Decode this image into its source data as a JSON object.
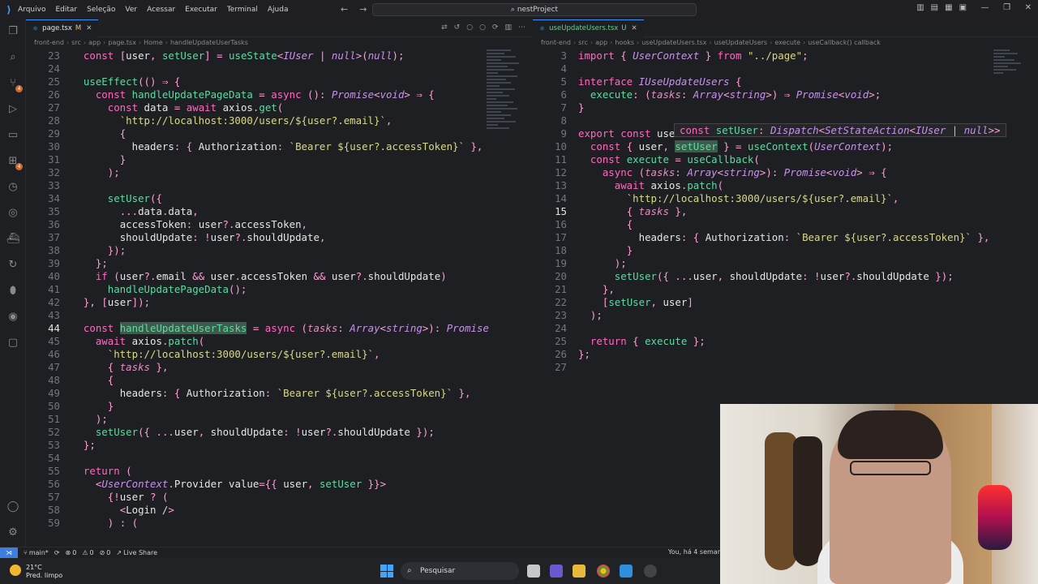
{
  "menu": [
    "Arquivo",
    "Editar",
    "Seleção",
    "Ver",
    "Acessar",
    "Executar",
    "Terminal",
    "Ajuda"
  ],
  "search_label": "nestProject",
  "left": {
    "tab": "page.tsx",
    "tab_status": "M",
    "breadcrumbs": [
      "front-end",
      "src",
      "app",
      "page.tsx",
      "Home",
      "handleUpdateUserTasks"
    ],
    "lines": [
      {
        "n": "23",
        "t": "  const [user, setUser] = useState<IUser | null>(null);"
      },
      {
        "n": "24",
        "t": ""
      },
      {
        "n": "25",
        "t": "  useEffect(() ⇒ {"
      },
      {
        "n": "26",
        "t": "    const handleUpdatePageData = async (): Promise<void> ⇒ {"
      },
      {
        "n": "27",
        "t": "      const data = await axios.get("
      },
      {
        "n": "28",
        "t": "        `http://localhost:3000/users/${user?.email}`,"
      },
      {
        "n": "29",
        "t": "        {"
      },
      {
        "n": "30",
        "t": "          headers: { Authorization: `Bearer ${user?.accessToken}` },"
      },
      {
        "n": "31",
        "t": "        }"
      },
      {
        "n": "32",
        "t": "      );"
      },
      {
        "n": "33",
        "t": ""
      },
      {
        "n": "34",
        "t": "      setUser({"
      },
      {
        "n": "35",
        "t": "        ...data.data,"
      },
      {
        "n": "36",
        "t": "        accessToken: user?.accessToken,"
      },
      {
        "n": "37",
        "t": "        shouldUpdate: !user?.shouldUpdate,"
      },
      {
        "n": "38",
        "t": "      });"
      },
      {
        "n": "39",
        "t": "    };"
      },
      {
        "n": "40",
        "t": "    if (user?.email && user.accessToken && user?.shouldUpdate)"
      },
      {
        "n": "41",
        "t": "      handleUpdatePageData();"
      },
      {
        "n": "42",
        "t": "  }, [user]);"
      },
      {
        "n": "43",
        "t": ""
      },
      {
        "n": "44",
        "t": "  const handleUpdateUserTasks = async (tasks: Array<string>): Promise"
      },
      {
        "n": "45",
        "t": "    await axios.patch("
      },
      {
        "n": "46",
        "t": "      `http://localhost:3000/users/${user?.email}`,"
      },
      {
        "n": "47",
        "t": "      { tasks },"
      },
      {
        "n": "48",
        "t": "      {"
      },
      {
        "n": "49",
        "t": "        headers: { Authorization: `Bearer ${user?.accessToken}` },"
      },
      {
        "n": "50",
        "t": "      }"
      },
      {
        "n": "51",
        "t": "    );"
      },
      {
        "n": "52",
        "t": "    setUser({ ...user, shouldUpdate: !user?.shouldUpdate });"
      },
      {
        "n": "53",
        "t": "  };"
      },
      {
        "n": "54",
        "t": ""
      },
      {
        "n": "55",
        "t": "  return ("
      },
      {
        "n": "56",
        "t": "    <UserContext.Provider value={{ user, setUser }}>"
      },
      {
        "n": "57",
        "t": "      {!user ? ("
      },
      {
        "n": "58",
        "t": "        <Login />"
      },
      {
        "n": "59",
        "t": "      ) : ("
      }
    ]
  },
  "right": {
    "tab": "useUpdateUsers.tsx",
    "tab_status": "U",
    "breadcrumbs": [
      "front-end",
      "src",
      "app",
      "hooks",
      "useUpdateUsers.tsx",
      "useUpdateUsers",
      "execute",
      "useCallback() callback"
    ],
    "lines": [
      {
        "n": "3",
        "t": "import { UserContext } from \"../page\";"
      },
      {
        "n": "4",
        "t": ""
      },
      {
        "n": "5",
        "t": "interface IUseUpdateUsers {"
      },
      {
        "n": "6",
        "t": "  execute: (tasks: Array<string>) ⇒ Promise<void>;"
      },
      {
        "n": "7",
        "t": "}"
      },
      {
        "n": "8",
        "t": ""
      },
      {
        "n": "9",
        "t": "export const use"
      },
      {
        "n": "10",
        "t": "  const { user, setUser } = useContext(UserContext);"
      },
      {
        "n": "11",
        "t": "  const execute = useCallback("
      },
      {
        "n": "12",
        "t": "    async (tasks: Array<string>): Promise<void> ⇒ {"
      },
      {
        "n": "13",
        "t": "      await axios.patch("
      },
      {
        "n": "14",
        "t": "        `http://localhost:3000/users/${user?.email}`,"
      },
      {
        "n": "15",
        "t": "        { tasks },"
      },
      {
        "n": "16",
        "t": "        {"
      },
      {
        "n": "17",
        "t": "          headers: { Authorization: `Bearer ${user?.accessToken}` },"
      },
      {
        "n": "18",
        "t": "        }"
      },
      {
        "n": "19",
        "t": "      );"
      },
      {
        "n": "20",
        "t": "      setUser({ ...user, shouldUpdate: !user?.shouldUpdate });"
      },
      {
        "n": "21",
        "t": "    },"
      },
      {
        "n": "22",
        "t": "    [setUser, user]"
      },
      {
        "n": "23",
        "t": "  );"
      },
      {
        "n": "24",
        "t": ""
      },
      {
        "n": "25",
        "t": "  return { execute };"
      },
      {
        "n": "26",
        "t": "};"
      },
      {
        "n": "27",
        "t": ""
      }
    ],
    "hover": "const setUser: Dispatch<SetStateAction<IUser | null>>"
  },
  "status": {
    "branch": "main*",
    "errors": "0",
    "warnings": "0",
    "ports": "0",
    "live_share": "Live Share",
    "blame": "You, há 4 semar"
  },
  "taskbar": {
    "temp": "21°C",
    "weather": "Pred. limpo",
    "search": "Pesquisar"
  }
}
